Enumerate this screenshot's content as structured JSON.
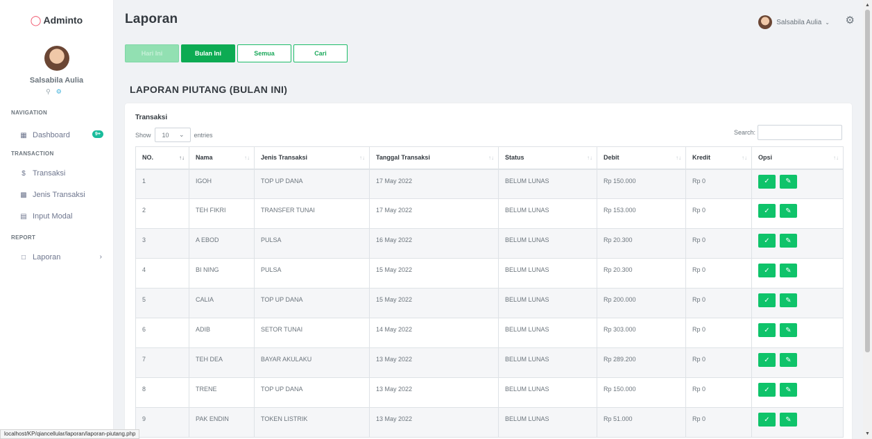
{
  "sidebar": {
    "logo": "Adminto",
    "user_name": "Salsabila Aulia",
    "nav_title": "NAVIGATION",
    "dashboard": "Dashboard",
    "dashboard_badge": "9+",
    "transaction_title": "TRANSACTION",
    "transaksi": "Transaksi",
    "jenis_transaksi": "Jenis Transaksi",
    "input_modal": "Input Modal",
    "report_title": "REPORT",
    "laporan": "Laporan"
  },
  "topbar": {
    "title": "Laporan",
    "user_name": "Salsabila Aulia"
  },
  "buttons": {
    "hari_ini": "Hari Ini",
    "bulan_ini": "Bulan Ini",
    "semua": "Semua",
    "cari": "Cari"
  },
  "section_title": "LAPORAN PIUTANG (BULAN INI)",
  "card": {
    "title": "Transaksi",
    "show": "Show",
    "entries_value": "10",
    "entries": "entries",
    "search_label": "Search:",
    "search_value": ""
  },
  "table": {
    "headers": [
      "NO.",
      "Nama",
      "Jenis Transaksi",
      "Tanggal Transaksi",
      "Status",
      "Debit",
      "Kredit",
      "Opsi"
    ],
    "rows": [
      [
        "1",
        "IGOH",
        "TOP UP DANA",
        "17 May 2022",
        "BELUM LUNAS",
        "Rp 150.000",
        "Rp 0"
      ],
      [
        "2",
        "TEH FIKRI",
        "TRANSFER TUNAI",
        "17 May 2022",
        "BELUM LUNAS",
        "Rp 153.000",
        "Rp 0"
      ],
      [
        "3",
        "A EBOD",
        "PULSA",
        "16 May 2022",
        "BELUM LUNAS",
        "Rp 20.300",
        "Rp 0"
      ],
      [
        "4",
        "BI NING",
        "PULSA",
        "15 May 2022",
        "BELUM LUNAS",
        "Rp 20.300",
        "Rp 0"
      ],
      [
        "5",
        "CALIA",
        "TOP UP DANA",
        "15 May 2022",
        "BELUM LUNAS",
        "Rp 200.000",
        "Rp 0"
      ],
      [
        "6",
        "ADIB",
        "SETOR TUNAI",
        "14 May 2022",
        "BELUM LUNAS",
        "Rp 303.000",
        "Rp 0"
      ],
      [
        "7",
        "TEH DEA",
        "BAYAR AKULAKU",
        "13 May 2022",
        "BELUM LUNAS",
        "Rp 289.200",
        "Rp 0"
      ],
      [
        "8",
        "TRENE",
        "TOP UP DANA",
        "13 May 2022",
        "BELUM LUNAS",
        "Rp 150.000",
        "Rp 0"
      ],
      [
        "9",
        "PAK ENDIN",
        "TOKEN LISTRIK",
        "13 May 2022",
        "BELUM LUNAS",
        "Rp 51.000",
        "Rp 0"
      ]
    ]
  },
  "status_url": "localhost/KP/qiancellular/laporan/laporan-piutang.php",
  "colors": {
    "accent_green": "#0dab53",
    "button_green": "#0fc36a",
    "logo_red": "#f1556c",
    "badge_teal": "#1abc9c"
  },
  "icons": {
    "dashboard": "grid-icon",
    "transaksi": "dollar-icon",
    "jenis_transaksi": "apps-icon",
    "input_modal": "card-icon",
    "laporan": "file-icon",
    "opsi_1": "check-circle-icon",
    "opsi_2": "edit-icon",
    "settings": "gear-icon"
  }
}
